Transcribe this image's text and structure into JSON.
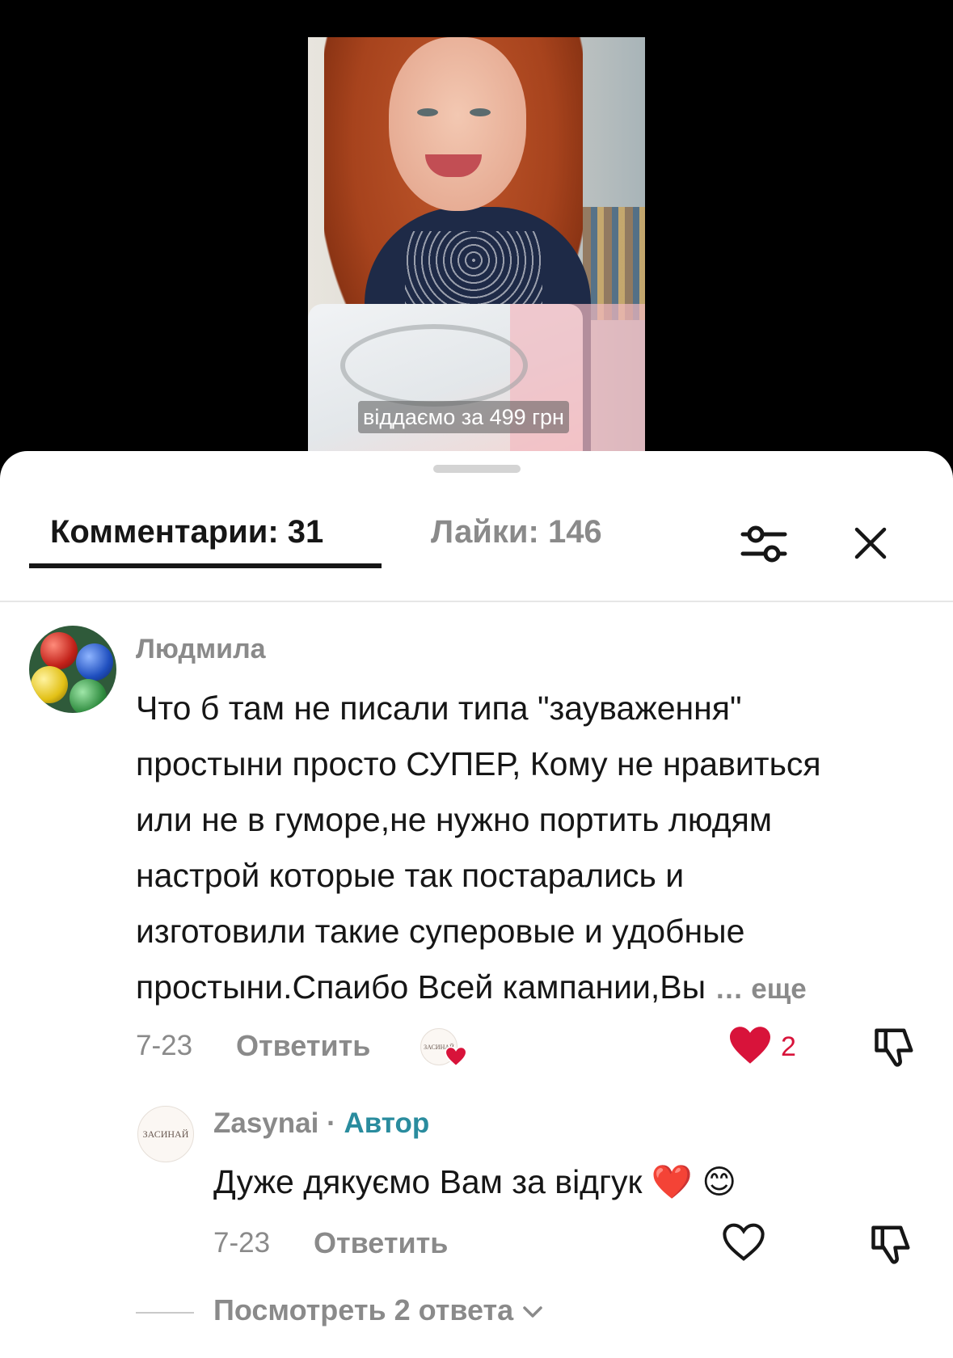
{
  "video": {
    "caption": "віддаємо за 499 грн"
  },
  "tabs": {
    "comments_label": "Комментарии: 31",
    "likes_label": "Лайки: 146"
  },
  "icons": {
    "filter": "filter-sliders-icon",
    "close": "close-icon",
    "heart": "heart-icon",
    "dislike": "thumb-down-icon",
    "chevron": "chevron-down-icon"
  },
  "colors": {
    "heart_red": "#d8133a",
    "author_teal": "#2a8c9e",
    "muted": "#8a8a8a"
  },
  "comment": {
    "author": "Людмила",
    "text": "Что б там не писали типа \"зауваження\"\nпростыни просто СУПЕР, Кому не нравиться\nили не в гуморе,не нужно портить людям\nнастрой которые так постарались и\nизготовили такие суперовые и удобные\nпростыни.Спаибо Всей кампании,Вы",
    "more_label": "… еще",
    "date": "7-23",
    "reply_label": "Ответить",
    "liked_by_creator_avatar_text": "ЗАСИНАЙ",
    "like_count": "2",
    "liked": true
  },
  "reply": {
    "author": "Zasynai",
    "separator": " · ",
    "author_badge": "Автор",
    "avatar_text": "ЗАСИНАЙ",
    "text": "Дуже дякуємо Вам за відгук ❤️ 😊",
    "date": "7-23",
    "reply_label": "Ответить",
    "liked": false
  },
  "view_replies_label": "Посмотреть 2 ответа"
}
